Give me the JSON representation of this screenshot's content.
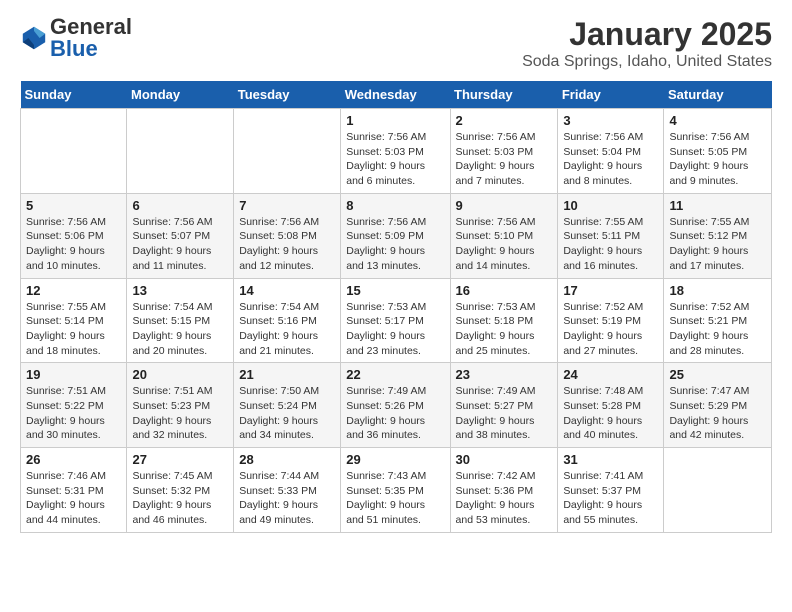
{
  "logo": {
    "general": "General",
    "blue": "Blue"
  },
  "title": "January 2025",
  "subtitle": "Soda Springs, Idaho, United States",
  "headers": [
    "Sunday",
    "Monday",
    "Tuesday",
    "Wednesday",
    "Thursday",
    "Friday",
    "Saturday"
  ],
  "weeks": [
    [
      {
        "day": "",
        "info": ""
      },
      {
        "day": "",
        "info": ""
      },
      {
        "day": "",
        "info": ""
      },
      {
        "day": "1",
        "info": "Sunrise: 7:56 AM\nSunset: 5:03 PM\nDaylight: 9 hours and 6 minutes."
      },
      {
        "day": "2",
        "info": "Sunrise: 7:56 AM\nSunset: 5:03 PM\nDaylight: 9 hours and 7 minutes."
      },
      {
        "day": "3",
        "info": "Sunrise: 7:56 AM\nSunset: 5:04 PM\nDaylight: 9 hours and 8 minutes."
      },
      {
        "day": "4",
        "info": "Sunrise: 7:56 AM\nSunset: 5:05 PM\nDaylight: 9 hours and 9 minutes."
      }
    ],
    [
      {
        "day": "5",
        "info": "Sunrise: 7:56 AM\nSunset: 5:06 PM\nDaylight: 9 hours and 10 minutes."
      },
      {
        "day": "6",
        "info": "Sunrise: 7:56 AM\nSunset: 5:07 PM\nDaylight: 9 hours and 11 minutes."
      },
      {
        "day": "7",
        "info": "Sunrise: 7:56 AM\nSunset: 5:08 PM\nDaylight: 9 hours and 12 minutes."
      },
      {
        "day": "8",
        "info": "Sunrise: 7:56 AM\nSunset: 5:09 PM\nDaylight: 9 hours and 13 minutes."
      },
      {
        "day": "9",
        "info": "Sunrise: 7:56 AM\nSunset: 5:10 PM\nDaylight: 9 hours and 14 minutes."
      },
      {
        "day": "10",
        "info": "Sunrise: 7:55 AM\nSunset: 5:11 PM\nDaylight: 9 hours and 16 minutes."
      },
      {
        "day": "11",
        "info": "Sunrise: 7:55 AM\nSunset: 5:12 PM\nDaylight: 9 hours and 17 minutes."
      }
    ],
    [
      {
        "day": "12",
        "info": "Sunrise: 7:55 AM\nSunset: 5:14 PM\nDaylight: 9 hours and 18 minutes."
      },
      {
        "day": "13",
        "info": "Sunrise: 7:54 AM\nSunset: 5:15 PM\nDaylight: 9 hours and 20 minutes."
      },
      {
        "day": "14",
        "info": "Sunrise: 7:54 AM\nSunset: 5:16 PM\nDaylight: 9 hours and 21 minutes."
      },
      {
        "day": "15",
        "info": "Sunrise: 7:53 AM\nSunset: 5:17 PM\nDaylight: 9 hours and 23 minutes."
      },
      {
        "day": "16",
        "info": "Sunrise: 7:53 AM\nSunset: 5:18 PM\nDaylight: 9 hours and 25 minutes."
      },
      {
        "day": "17",
        "info": "Sunrise: 7:52 AM\nSunset: 5:19 PM\nDaylight: 9 hours and 27 minutes."
      },
      {
        "day": "18",
        "info": "Sunrise: 7:52 AM\nSunset: 5:21 PM\nDaylight: 9 hours and 28 minutes."
      }
    ],
    [
      {
        "day": "19",
        "info": "Sunrise: 7:51 AM\nSunset: 5:22 PM\nDaylight: 9 hours and 30 minutes."
      },
      {
        "day": "20",
        "info": "Sunrise: 7:51 AM\nSunset: 5:23 PM\nDaylight: 9 hours and 32 minutes."
      },
      {
        "day": "21",
        "info": "Sunrise: 7:50 AM\nSunset: 5:24 PM\nDaylight: 9 hours and 34 minutes."
      },
      {
        "day": "22",
        "info": "Sunrise: 7:49 AM\nSunset: 5:26 PM\nDaylight: 9 hours and 36 minutes."
      },
      {
        "day": "23",
        "info": "Sunrise: 7:49 AM\nSunset: 5:27 PM\nDaylight: 9 hours and 38 minutes."
      },
      {
        "day": "24",
        "info": "Sunrise: 7:48 AM\nSunset: 5:28 PM\nDaylight: 9 hours and 40 minutes."
      },
      {
        "day": "25",
        "info": "Sunrise: 7:47 AM\nSunset: 5:29 PM\nDaylight: 9 hours and 42 minutes."
      }
    ],
    [
      {
        "day": "26",
        "info": "Sunrise: 7:46 AM\nSunset: 5:31 PM\nDaylight: 9 hours and 44 minutes."
      },
      {
        "day": "27",
        "info": "Sunrise: 7:45 AM\nSunset: 5:32 PM\nDaylight: 9 hours and 46 minutes."
      },
      {
        "day": "28",
        "info": "Sunrise: 7:44 AM\nSunset: 5:33 PM\nDaylight: 9 hours and 49 minutes."
      },
      {
        "day": "29",
        "info": "Sunrise: 7:43 AM\nSunset: 5:35 PM\nDaylight: 9 hours and 51 minutes."
      },
      {
        "day": "30",
        "info": "Sunrise: 7:42 AM\nSunset: 5:36 PM\nDaylight: 9 hours and 53 minutes."
      },
      {
        "day": "31",
        "info": "Sunrise: 7:41 AM\nSunset: 5:37 PM\nDaylight: 9 hours and 55 minutes."
      },
      {
        "day": "",
        "info": ""
      }
    ]
  ]
}
